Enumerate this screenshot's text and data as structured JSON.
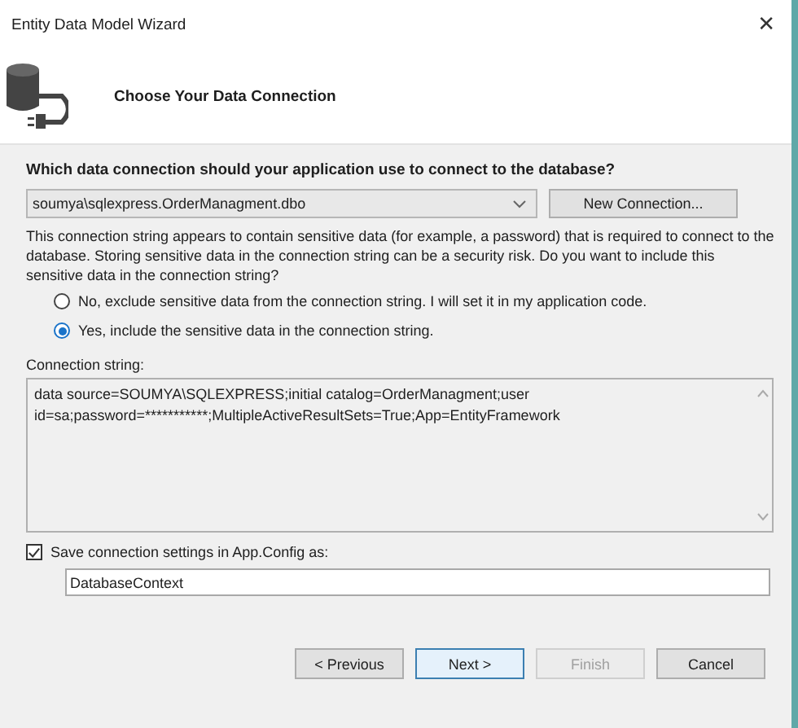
{
  "window": {
    "title": "Entity Data Model Wizard",
    "close": "✕"
  },
  "header": {
    "title": "Choose Your Data Connection"
  },
  "question": "Which data connection should your application use to connect to the database?",
  "connection": {
    "value": "soumya\\sqlexpress.OrderManagment.dbo",
    "new_button": "New Connection..."
  },
  "warning": "This connection string appears to contain sensitive data (for example, a password) that is required to connect to the database. Storing sensitive data in the connection string can be a security risk. Do you want to include this sensitive data in the connection string?",
  "options": [
    {
      "label": "No, exclude sensitive data from the connection string. I will set it in my application code.",
      "selected": false
    },
    {
      "label": "Yes, include the sensitive data in the connection string.",
      "selected": true
    }
  ],
  "connection_string": {
    "label": "Connection string:",
    "value": "data source=SOUMYA\\SQLEXPRESS;initial catalog=OrderManagment;user id=sa;password=***********;MultipleActiveResultSets=True;App=EntityFramework"
  },
  "save_settings": {
    "label": "Save connection settings in App.Config as:",
    "checked": true,
    "value": "DatabaseContext"
  },
  "buttons": [
    {
      "label": "< Previous",
      "disabled": false,
      "default": false
    },
    {
      "label": "Next >",
      "disabled": false,
      "default": true
    },
    {
      "label": "Finish",
      "disabled": true,
      "default": false
    },
    {
      "label": "Cancel",
      "disabled": false,
      "default": false
    }
  ]
}
